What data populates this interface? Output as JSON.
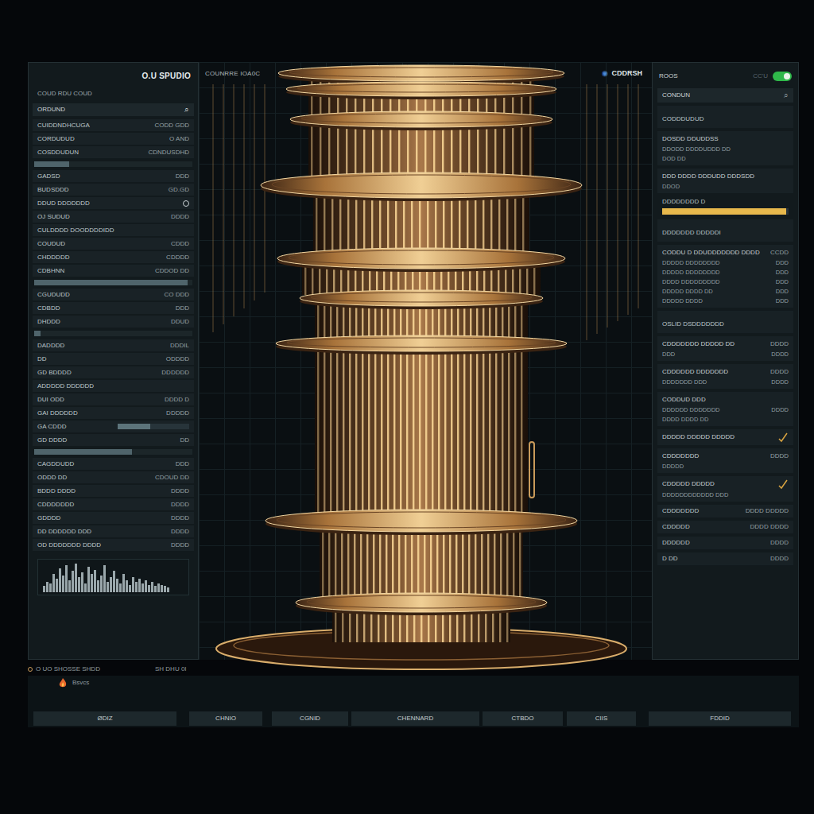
{
  "header": {
    "left_title": "O.U SPUDIO",
    "center_label": "COUNRRE IOA0C",
    "right_icon": "◉",
    "right_label": "CDDRSH",
    "right_title": "ROOS",
    "right_value": "CC'U",
    "toggle_on": true
  },
  "left_panel": {
    "heading": "COUD RDU COUD",
    "search": "ORDUND",
    "search_icon": "⌕",
    "rows": [
      {
        "kind": "row",
        "label": "CUIDDNDHCUGA",
        "value": "CODD GDD"
      },
      {
        "kind": "row",
        "label": "CORDUDUD",
        "value": "O AND"
      },
      {
        "kind": "row",
        "label": "COSDDUDUN",
        "value": "CDNDUSDHD"
      },
      {
        "kind": "bar",
        "level": 0.22
      },
      {
        "kind": "row",
        "label": "GADSD",
        "value": "DDD"
      },
      {
        "kind": "row",
        "label": "BUDSDDD",
        "value": "GD.GD"
      },
      {
        "kind": "toggle",
        "label": "DDUD DDDDDDD",
        "on": false
      },
      {
        "kind": "row",
        "label": "OJ SUDUD",
        "value": "DDDD"
      },
      {
        "kind": "text",
        "label": "CULDDDD DOODDDDIDD"
      },
      {
        "kind": "row",
        "label": "COUDUD",
        "value": "CDDD"
      },
      {
        "kind": "row",
        "label": "CHDDDDD",
        "value": "CDDDD"
      },
      {
        "kind": "row",
        "label": "CDBHNN",
        "value": "CDDOD DD"
      },
      {
        "kind": "bar",
        "level": 0.97
      },
      {
        "kind": "row",
        "label": "CGUDUDD",
        "value": "CO DDD"
      },
      {
        "kind": "row",
        "label": "CDBDD",
        "value": "DDD"
      },
      {
        "kind": "row",
        "label": "DHDDD",
        "value": "DDUD"
      },
      {
        "kind": "bar",
        "level": 0.04
      },
      {
        "kind": "row",
        "label": "DADDDD",
        "value": "DDDIL"
      },
      {
        "kind": "row",
        "label": "DD",
        "value": "ODDDD"
      },
      {
        "kind": "row",
        "label": "GD BDDDD",
        "value": "DDDDDD"
      },
      {
        "kind": "text",
        "label": "ADDDDD DDDDDD"
      },
      {
        "kind": "row",
        "label": "DUI ODD",
        "value": "DDDD D"
      },
      {
        "kind": "row",
        "label": "GAI DDDDDD",
        "value": "DDDDD"
      },
      {
        "kind": "labelbar",
        "label": "GA CDDD",
        "level": 0.45
      },
      {
        "kind": "row",
        "label": "GD DDDD",
        "value": "DD"
      },
      {
        "kind": "bar",
        "level": 0.62
      },
      {
        "kind": "row",
        "label": "CAGDDUDD",
        "value": "DDD"
      },
      {
        "kind": "row",
        "label": "ODDD DD",
        "value": "CDOUD DD"
      },
      {
        "kind": "row",
        "label": "BDDD DDDD",
        "value": "DDDD"
      },
      {
        "kind": "row",
        "label": "CDDDDDDD",
        "value": "DDDD"
      },
      {
        "kind": "row",
        "label": "GDDDD",
        "value": "DDDD"
      },
      {
        "kind": "row",
        "label": "DD DDDDDD DDD",
        "value": "DDDD"
      },
      {
        "kind": "row",
        "label": "OD DDDDDDD DDDD",
        "value": "DDDD"
      }
    ],
    "chart": {
      "values": [
        0.2,
        0.35,
        0.3,
        0.6,
        0.45,
        0.8,
        0.55,
        0.9,
        0.4,
        0.7,
        0.95,
        0.5,
        0.65,
        0.3,
        0.85,
        0.6,
        0.75,
        0.4,
        0.55,
        0.9,
        0.35,
        0.5,
        0.7,
        0.45,
        0.3,
        0.6,
        0.4,
        0.25,
        0.5,
        0.35,
        0.45,
        0.3,
        0.4,
        0.25,
        0.35,
        0.2,
        0.3,
        0.25,
        0.2,
        0.15
      ]
    }
  },
  "right_panel": {
    "items": [
      {
        "kind": "search",
        "label": "CONDUN",
        "icon": "⌕"
      },
      {
        "kind": "text",
        "label": "CODDDUDUD"
      },
      {
        "kind": "group",
        "title": "DOSDD DDUDDSS",
        "lines": [
          {
            "label": "DDODD DDDDUDDD DD"
          },
          {
            "label": "DOD DD"
          }
        ]
      },
      {
        "kind": "group",
        "title": "DDD DDDD DDDUDD DDDSDD",
        "lines": [
          {
            "label": "DDOD"
          }
        ]
      },
      {
        "kind": "bar",
        "label": "DDDDDDDD D",
        "level": 0.98
      },
      {
        "kind": "text",
        "label": "DDDDDDD DDDDDI"
      },
      {
        "kind": "group",
        "title": "CODDU D DDUDDDDDDD DDDD",
        "value": "CCDD",
        "lines": [
          {
            "label": "DDDDD DDDDDDDD",
            "value": "DDD"
          },
          {
            "label": "DDDDD DDDDDDDD",
            "value": "DDD"
          },
          {
            "label": "DDDD DDDDDDDDD",
            "value": "DDD"
          },
          {
            "label": "DDDDD DDDD DD",
            "value": "DDD"
          },
          {
            "label": "DDDDD DDDD",
            "value": "DDD"
          }
        ]
      },
      {
        "kind": "text",
        "label": "OSLID DSDDDDDDD"
      },
      {
        "kind": "group",
        "title": "CDDDDDDD DDDDD DD",
        "value": "DDDD",
        "lines": [
          {
            "label": "DDD",
            "value": "DDDD"
          }
        ]
      },
      {
        "kind": "group",
        "title": "CDDDDDD DDDDDDD",
        "value": "DDDD",
        "lines": [
          {
            "label": "DDDDDDD DDD",
            "value": "DDDD"
          }
        ]
      },
      {
        "kind": "group",
        "title": "CODDUD DDD",
        "lines": [
          {
            "label": "DDDDDD DDDDDDD",
            "value": "DDDD"
          },
          {
            "label": "DDDD DDDD DD"
          }
        ]
      },
      {
        "kind": "check",
        "label": "DDDDD DDDDD DDDDD",
        "checked": true
      },
      {
        "kind": "group",
        "title": "CDDDDDDD",
        "value": "DDDD",
        "lines": [
          {
            "label": "DDDDD"
          }
        ]
      },
      {
        "kind": "check",
        "label": "CDDDDD DDDDD",
        "checked": true,
        "lines": [
          {
            "label": "DDDDDDDDDDDD DDD"
          }
        ]
      },
      {
        "kind": "row",
        "label": "CDDDDDDD",
        "value": "DDDD DDDDD"
      },
      {
        "kind": "row",
        "label": "CDDDDD",
        "value": "DDDD DDDD"
      },
      {
        "kind": "row",
        "label": "DDDDDD",
        "value": "DDDD"
      },
      {
        "kind": "row",
        "label": "D DD",
        "value": "DDDD"
      }
    ]
  },
  "footer": {
    "status": [
      "O UO SHOSSE SHDD",
      "SH DHU 0I"
    ],
    "flame_label": "Bsvcs",
    "buttons": [
      {
        "label": "ØDIZ",
        "selected": false
      },
      {
        "label": "CHNIO",
        "selected": false
      },
      {
        "label": "CGNID",
        "selected": false
      },
      {
        "label": "CHENNARD",
        "selected": false
      },
      {
        "label": "CTBDO",
        "selected": false
      },
      {
        "label": "CIIS",
        "selected": false
      },
      {
        "label": "FDDID",
        "selected": false
      }
    ]
  }
}
